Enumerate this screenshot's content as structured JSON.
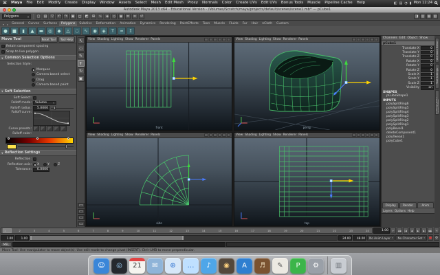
{
  "menubar": {
    "apple_icon": "⌘",
    "app_name": "Maya",
    "items": [
      "File",
      "Edit",
      "Modify",
      "Create",
      "Display",
      "Window",
      "Assets",
      "Select",
      "Mesh",
      "Edit Mesh",
      "Proxy",
      "Normals",
      "Color",
      "Create UVs",
      "Edit UVs",
      "Bonus Tools",
      "Muscle",
      "Pipeline Cache",
      "Help"
    ],
    "extras": [
      {
        "name": "volume-icon",
        "glyph": "◧"
      },
      {
        "name": "display-icon",
        "glyph": "▤"
      },
      {
        "name": "wifi-icon",
        "glyph": "◔"
      },
      {
        "name": "battery-icon",
        "glyph": "▮"
      }
    ],
    "clock": "Mon 12:24"
  },
  "window": {
    "title": "Autodesk Maya 2013 x64 - Educational Version - /Volumes/Scratch/maya/projects/default/scenes/scene1.mb* --- pCube1"
  },
  "status_line": {
    "menu_set": "Polygons",
    "buttons": [
      {
        "name": "new-scene-icon",
        "glyph": "▢"
      },
      {
        "name": "open-scene-icon",
        "glyph": "▤"
      },
      {
        "name": "save-scene-icon",
        "glyph": "▽"
      },
      {
        "name": "undo-icon",
        "glyph": "↶"
      },
      {
        "name": "redo-icon",
        "glyph": "↷"
      },
      {
        "name": "select-hierarchy-icon",
        "glyph": "▣"
      },
      {
        "name": "select-object-icon",
        "glyph": "◻"
      },
      {
        "name": "select-component-icon",
        "glyph": "◩"
      },
      {
        "name": "snap-grid-icon",
        "glyph": "⊞"
      },
      {
        "name": "snap-curve-icon",
        "glyph": "∿"
      },
      {
        "name": "snap-point-icon",
        "glyph": "◈"
      },
      {
        "name": "snap-view-plane-icon",
        "glyph": "◇"
      },
      {
        "name": "make-live-icon",
        "glyph": "◉"
      },
      {
        "name": "input-connections-icon",
        "glyph": "≡"
      },
      {
        "name": "output-connections-icon",
        "glyph": "≋"
      },
      {
        "name": "construction-history-icon",
        "glyph": "↺"
      }
    ],
    "right_buttons": [
      {
        "name": "toggle-attribute-editor-icon",
        "glyph": "◨"
      },
      {
        "name": "toggle-tool-settings-icon",
        "glyph": "▥"
      },
      {
        "name": "toggle-channel-box-icon",
        "glyph": "▦"
      },
      {
        "name": "toggle-panel-icon",
        "glyph": "▧"
      }
    ]
  },
  "shelf": {
    "tabs": [
      {
        "label": "General",
        "active": false
      },
      {
        "label": "Curves",
        "active": false
      },
      {
        "label": "Surfaces",
        "active": false
      },
      {
        "label": "Polygons",
        "active": true
      },
      {
        "label": "Subdivs",
        "active": false
      },
      {
        "label": "Deformation",
        "active": false
      },
      {
        "label": "Animation",
        "active": false
      },
      {
        "label": "Dynamics",
        "active": false
      },
      {
        "label": "Rendering",
        "active": false
      },
      {
        "label": "PaintEffects",
        "active": false
      },
      {
        "label": "Toon",
        "active": false
      },
      {
        "label": "Muscle",
        "active": false
      },
      {
        "label": "Fluids",
        "active": false
      },
      {
        "label": "Fur",
        "active": false
      },
      {
        "label": "Hair",
        "active": false
      },
      {
        "label": "nCloth",
        "active": false
      },
      {
        "label": "Custom",
        "active": false
      }
    ],
    "icons": [
      {
        "name": "polygon-sphere-icon",
        "glyph": "●",
        "bg": "#3a5f68"
      },
      {
        "name": "polygon-cube-icon",
        "glyph": "■",
        "bg": "#40666e"
      },
      {
        "name": "polygon-cylinder-icon",
        "glyph": "▮",
        "bg": "#3a5f68"
      },
      {
        "name": "polygon-cone-icon",
        "glyph": "▲",
        "bg": "#40666e"
      },
      {
        "name": "polygon-plane-icon",
        "glyph": "▬",
        "bg": "#3a5f68"
      },
      {
        "name": "polygon-torus-icon",
        "glyph": "◎",
        "bg": "#40666e"
      },
      {
        "name": "polygon-prism-icon",
        "glyph": "◆",
        "bg": "#3a5f68"
      },
      {
        "name": "polygon-pyramid-icon",
        "glyph": "△",
        "bg": "#40666e"
      },
      {
        "name": "polygon-pipe-icon",
        "glyph": "◌",
        "bg": "#3a5f68"
      },
      {
        "name": "polygon-helix-icon",
        "glyph": "∿",
        "bg": "#40666e"
      },
      {
        "name": "polygon-soccer-icon",
        "glyph": "◉",
        "bg": "#3a5f68"
      },
      {
        "name": "polygon-platonic-icon",
        "glyph": "◈",
        "bg": "#40666e"
      },
      {
        "name": "poly-text-icon",
        "glyph": "T",
        "bg": "#3a5f68"
      },
      {
        "name": "smooth-icon",
        "glyph": "≈",
        "bg": "#40666e"
      },
      {
        "name": "extrude-icon",
        "glyph": "↥",
        "bg": "#3a5f68"
      }
    ]
  },
  "toolbox": {
    "tools": [
      {
        "name": "select-tool",
        "glyph": "↖",
        "active": false
      },
      {
        "name": "lasso-select-tool",
        "glyph": "◌",
        "active": false
      },
      {
        "name": "paint-select-tool",
        "glyph": "✎",
        "active": false
      },
      {
        "name": "move-tool",
        "glyph": "+",
        "active": true
      },
      {
        "name": "rotate-tool",
        "glyph": "↻",
        "active": false
      },
      {
        "name": "scale-tool",
        "glyph": "▣",
        "active": false
      }
    ]
  },
  "tool_settings": {
    "title": "Move Tool",
    "reset": "Reset Tool",
    "help": "Tool Help",
    "opt_retain": "Retain component spacing",
    "opt_snap_live": "Snap to live polygon",
    "sec_common": "Common Selection Options",
    "selection_style": "Selection Style:",
    "style_options": [
      {
        "label": "Marquee",
        "selected": true
      },
      {
        "label": "Camera based select",
        "selected": false
      },
      {
        "label": "Drag",
        "selected": false
      },
      {
        "label": "Camera based paint",
        "selected": false
      }
    ],
    "sec_soft": "Soft Selection",
    "soft_select": "Soft Select:",
    "falloff_mode": "Falloff mode:",
    "falloff_mode_value": "Volume",
    "falloff_radius": "Falloff radius:",
    "falloff_radius_value": "5.0000",
    "falloff_curve": "Falloff curve:",
    "curve_presets": "Curve presets:",
    "falloff_color": "Falloff color:",
    "sec_reflection": "Reflection Settings",
    "reflection": "Reflection:",
    "reflection_axis": "Reflection axis:",
    "axis_options": [
      {
        "label": "X",
        "selected": true
      },
      {
        "label": "Y",
        "selected": false
      },
      {
        "label": "Z",
        "selected": false
      }
    ],
    "tolerance": "Tolerance:",
    "tolerance_value": "0.0000"
  },
  "viewport": {
    "menu": [
      "View",
      "Shading",
      "Lighting",
      "Show",
      "Renderer",
      "Panels"
    ],
    "cameras": {
      "front": "front",
      "persp": "persp",
      "side": "side",
      "top": "top"
    }
  },
  "channel_box": {
    "menu": [
      "Channels",
      "Edit",
      "Object",
      "Show"
    ],
    "node": "pCube1",
    "attrs": [
      {
        "label": "Translate X",
        "value": "0"
      },
      {
        "label": "Translate Y",
        "value": "0"
      },
      {
        "label": "Translate Z",
        "value": "0"
      },
      {
        "label": "Rotate X",
        "value": "0"
      },
      {
        "label": "Rotate Y",
        "value": "0"
      },
      {
        "label": "Rotate Z",
        "value": "0"
      },
      {
        "label": "Scale X",
        "value": "1"
      },
      {
        "label": "Scale Y",
        "value": "1"
      },
      {
        "label": "Scale Z",
        "value": "1"
      },
      {
        "label": "Visibility",
        "value": "on"
      }
    ],
    "shapes_label": "SHAPES",
    "shape_node": "pCubeShape1",
    "inputs_label": "INPUTS",
    "inputs": [
      "polySplitRing6",
      "polySplitRing5",
      "polySplitRing4",
      "polySplitRing3",
      "polySplitRing2",
      "polySplitRing1",
      "polyBevel1",
      "deleteComponent1",
      "polyTweak1",
      "polyCube1"
    ],
    "bottom_tabs": [
      "Display",
      "Render",
      "Anim"
    ],
    "layer_menu": [
      "Layers",
      "Options",
      "Help"
    ]
  },
  "right_strip": {
    "tabs": [
      "Attribute Editor",
      "Tool Settings",
      "Channel Box / Layer Editor"
    ]
  },
  "timeline": {
    "ticks": [
      "1",
      "2",
      "3",
      "4",
      "5",
      "6",
      "7",
      "8",
      "9",
      "10",
      "11",
      "12",
      "13",
      "14",
      "15",
      "16",
      "17",
      "18",
      "19",
      "20",
      "21",
      "22",
      "23",
      "24"
    ],
    "current_time": "1.00",
    "playback": [
      {
        "name": "go-to-start-button",
        "glyph": "⇤"
      },
      {
        "name": "step-back-frame-button",
        "glyph": "◀◀"
      },
      {
        "name": "step-back-key-button",
        "glyph": "|◀"
      },
      {
        "name": "play-backwards-button",
        "glyph": "◀"
      },
      {
        "name": "play-forwards-button",
        "glyph": "▶"
      },
      {
        "name": "step-forward-key-button",
        "glyph": "▶|"
      },
      {
        "name": "step-forward-frame-button",
        "glyph": "▶▶"
      },
      {
        "name": "go-to-end-button",
        "glyph": "⇥"
      }
    ]
  },
  "range_slider": {
    "anim_start": "1.00",
    "play_start": "1.00",
    "play_end": "24.00",
    "anim_end": "48.00",
    "anim_layer": "No Anim Layer",
    "character_set": "No Character Set"
  },
  "command_line": {
    "label": "MEL"
  },
  "help_line": {
    "text": "Move Tool: Use manipulator to move object(s). Use edit mode to change pivot (INSERT). Ctrl+LMB to move perpendicular."
  },
  "dock": {
    "icons": [
      {
        "name": "finder",
        "glyph": "☺",
        "bg": "#3a86d8",
        "fg": "#ffffff",
        "divider": false
      },
      {
        "name": "dashboard",
        "glyph": "◎",
        "bg": "#26292e",
        "fg": "#9fd4ff",
        "divider": false
      },
      {
        "name": "calendar",
        "glyph": "21",
        "bg": "#f5f4ef",
        "fg": "#333333",
        "divider": false
      },
      {
        "name": "mail",
        "glyph": "✉",
        "bg": "#8fb4d8",
        "fg": "#ffffff",
        "divider": false
      },
      {
        "name": "safari",
        "glyph": "⊕",
        "bg": "#d6e7f8",
        "fg": "#2a6fd0",
        "divider": false
      },
      {
        "name": "messages",
        "glyph": "…",
        "bg": "#bfe0ff",
        "fg": "#2a6fd0",
        "divider": false
      },
      {
        "name": "itunes",
        "glyph": "♪",
        "bg": "#4fa6e8",
        "fg": "#ffffff",
        "divider": false
      },
      {
        "name": "photo-booth",
        "glyph": "◉",
        "bg": "#54483c",
        "fg": "#ffd27f",
        "divider": false
      },
      {
        "name": "app-store",
        "glyph": "A",
        "bg": "#2f7fd0",
        "fg": "#ffffff",
        "divider": false
      },
      {
        "name": "garageband",
        "glyph": "♬",
        "bg": "#7a5230",
        "fg": "#f0e0c0",
        "divider": false
      },
      {
        "name": "textedit",
        "glyph": "✎",
        "bg": "#ece9e2",
        "fg": "#555555",
        "divider": false
      },
      {
        "name": "processing",
        "glyph": "P",
        "bg": "#3cb54a",
        "fg": "#ffffff",
        "divider": false
      },
      {
        "name": "system-preferences",
        "glyph": "⚙",
        "bg": "#9aa0a8",
        "fg": "#ffffff",
        "divider": false
      },
      {
        "name": "trash",
        "glyph": "▥",
        "bg": "#c8ccd2",
        "fg": "#6a6f76",
        "divider": true
      }
    ]
  },
  "colors": {
    "wireframe_selected": "#49c06a",
    "manip_x_selected": "#ffd400",
    "manip_y": "#3ddc3d",
    "manip_z": "#4a7dff",
    "manip_center": "#cfe9ff",
    "falloff_swatch": "#ffe34d"
  }
}
